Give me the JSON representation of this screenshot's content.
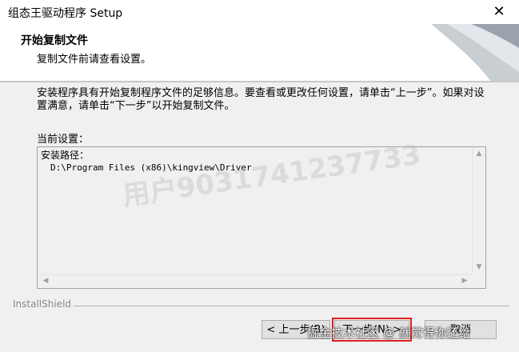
{
  "window": {
    "title": "组态王驱动程序 Setup",
    "close_glyph": "✕"
  },
  "header": {
    "title": "开始复制文件",
    "subtitle": "复制文件前请查看设置。"
  },
  "body": {
    "intro": "安装程序具有开始复制程序文件的足够信息。要查看或更改任何设置，请单击“上一步”。如果对设置满意，请单击“下一步”以开始复制文件。",
    "current_settings_label": "当前设置：",
    "settings": {
      "install_path_label": "安装路径：",
      "install_path_value": "D:\\Program Files (x86)\\kingview\\Driver"
    }
  },
  "footer": {
    "brand": "InstallShield",
    "back_label": "< 上一步(B)",
    "next_label": "下一步(N) >",
    "cancel_label": "取消"
  },
  "overlay": {
    "watermark": "用户9031741237733",
    "credit": "掘金技术社区 @ 就觉得你还给"
  },
  "colors": {
    "highlight_box": "#e02020",
    "panel_bg": "#f0f0f0"
  }
}
